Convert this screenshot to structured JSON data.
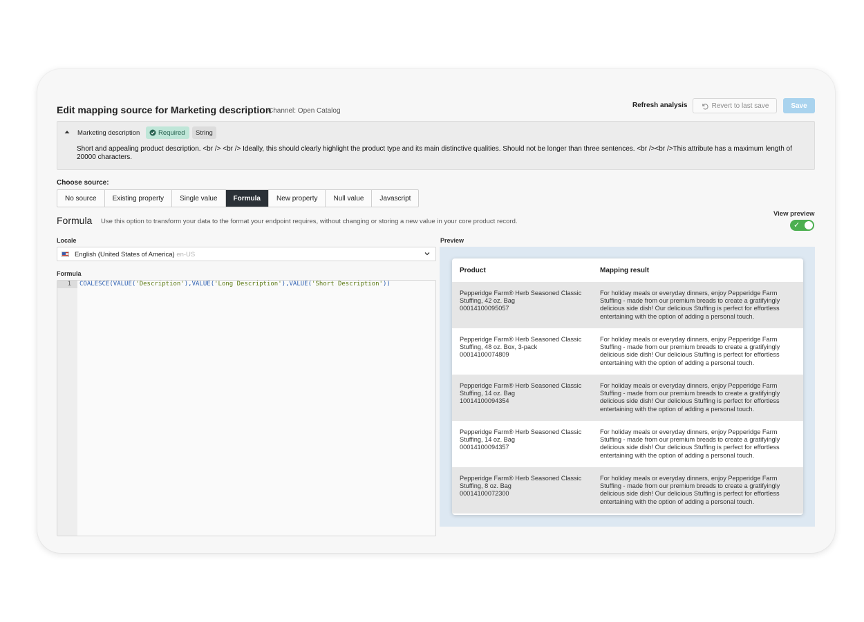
{
  "header": {
    "title": "Edit mapping source for Marketing description",
    "channel": "Channel: Open Catalog",
    "refresh_label": "Refresh analysis",
    "revert_label": "Revert to last save",
    "save_label": "Save"
  },
  "attribute": {
    "name": "Marketing description",
    "required_label": "Required",
    "type_label": "String",
    "description": "Short and appealing product description. <br /> <br /> Ideally, this should clearly highlight the product type and its main distinctive qualities. Should not be longer than three sentences. <br /><br />This attribute has a maximum length of 20000 characters."
  },
  "source": {
    "label": "Choose source:",
    "options": [
      "No source",
      "Existing property",
      "Single value",
      "Formula",
      "New property",
      "Null value",
      "Javascript"
    ],
    "selected": "Formula"
  },
  "formula_section": {
    "title": "Formula",
    "description": "Use this option to transform your data to the format your endpoint requires, without changing or storing a new value in your core product record.",
    "view_preview_label": "View preview",
    "view_preview_on": true
  },
  "locale": {
    "label": "Locale",
    "value": "English (United States of America)",
    "code": "en-US"
  },
  "editor": {
    "label": "Formula",
    "line_number": "1",
    "code": "COALESCE(VALUE('Description'),VALUE('Long Description'),VALUE('Short Description'))"
  },
  "preview": {
    "label": "Preview",
    "columns": [
      "Product",
      "Mapping result"
    ],
    "rows": [
      {
        "product_name": "Pepperidge Farm® Herb Seasoned Classic Stuffing, 42 oz. Bag",
        "product_code": "00014100095057",
        "result": "For holiday meals or everyday dinners, enjoy Pepperidge Farm Stuffing - made from our premium breads to create a gratifyingly delicious side dish! Our delicious Stuffing is perfect for effortless entertaining with the option of adding a personal touch."
      },
      {
        "product_name": "Pepperidge Farm® Herb Seasoned Classic Stuffing, 48 oz. Box, 3-pack",
        "product_code": "00014100074809",
        "result": "For holiday meals or everyday dinners, enjoy Pepperidge Farm Stuffing - made from our premium breads to create a gratifyingly delicious side dish! Our delicious Stuffing is perfect for effortless entertaining with the option of adding a personal touch."
      },
      {
        "product_name": "Pepperidge Farm® Herb Seasoned Classic Stuffing, 14 oz. Bag",
        "product_code": "10014100094354",
        "result": "For holiday meals or everyday dinners, enjoy Pepperidge Farm Stuffing - made from our premium breads to create a gratifyingly delicious side dish! Our delicious Stuffing is perfect for effortless entertaining with the option of adding a personal touch."
      },
      {
        "product_name": "Pepperidge Farm® Herb Seasoned Classic Stuffing, 14 oz. Bag",
        "product_code": "00014100094357",
        "result": "For holiday meals or everyday dinners, enjoy Pepperidge Farm Stuffing - made from our premium breads to create a gratifyingly delicious side dish! Our delicious Stuffing is perfect for effortless entertaining with the option of adding a personal touch."
      },
      {
        "product_name": "Pepperidge Farm® Herb Seasoned Classic Stuffing, 8 oz. Bag",
        "product_code": "00014100072300",
        "result": "For holiday meals or everyday dinners, enjoy Pepperidge Farm Stuffing - made from our premium breads to create a gratifyingly delicious side dish! Our delicious Stuffing is perfect for effortless entertaining with the option of adding a personal touch."
      }
    ]
  },
  "icons": {
    "revert": "undo-icon",
    "required": "check-circle-icon",
    "collapse": "caret-up-icon",
    "locale_flag": "us-flag-icon",
    "dropdown": "chevron-down-icon",
    "toggle_check": "check-icon"
  },
  "colors": {
    "save_button": "#a9d3ee",
    "active_segment": "#2b3137",
    "required_badge": "#bfe6d8",
    "toggle_on": "#4caf50",
    "preview_background": "#dde8f2"
  }
}
